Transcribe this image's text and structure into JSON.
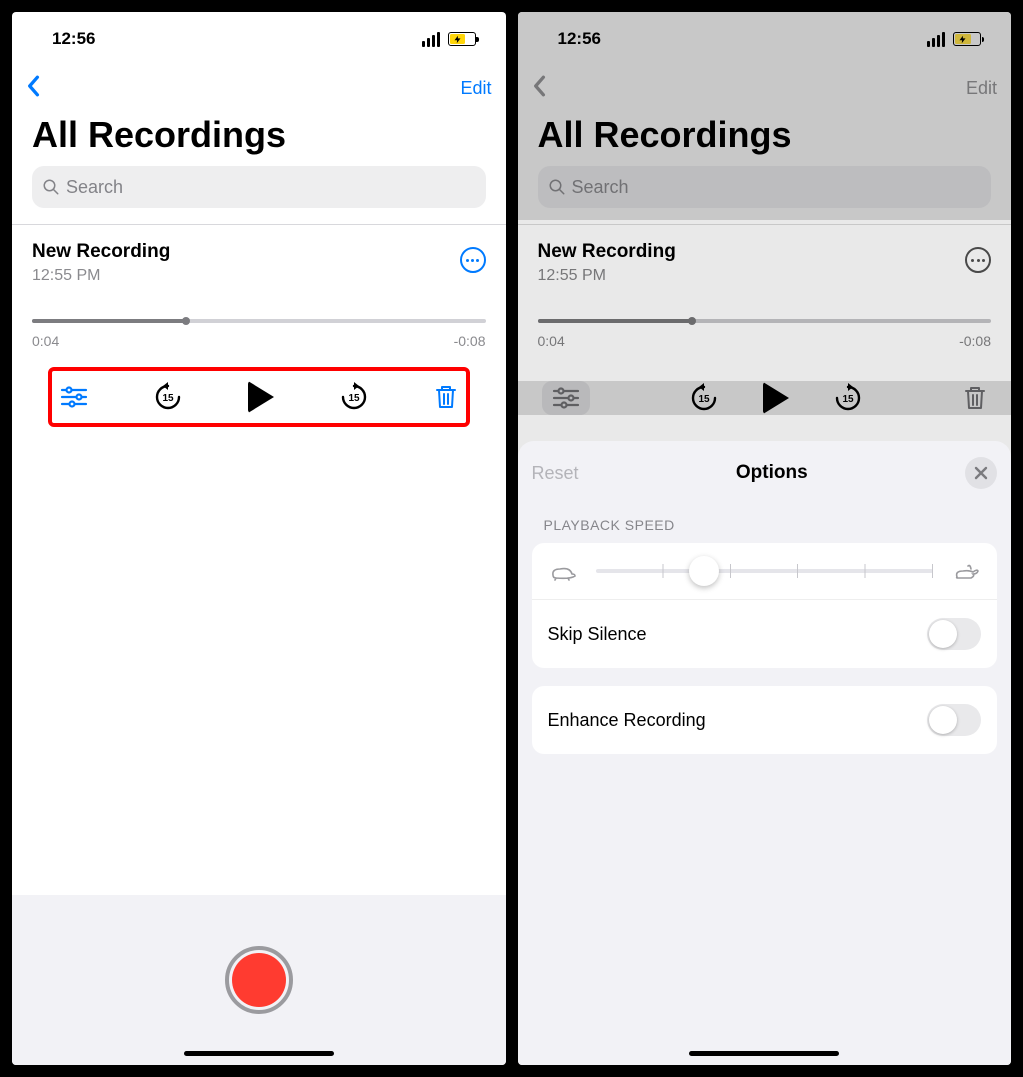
{
  "status": {
    "time": "12:56"
  },
  "nav": {
    "edit_label": "Edit"
  },
  "title": "All Recordings",
  "search": {
    "placeholder": "Search"
  },
  "recording": {
    "title": "New Recording",
    "subtitle": "12:55 PM",
    "elapsed": "0:04",
    "remaining": "-0:08",
    "progress_pct": 34
  },
  "options": {
    "reset_label": "Reset",
    "title": "Options",
    "playback_speed_label": "PLAYBACK SPEED",
    "speed_knob_pct": 32,
    "skip_silence_label": "Skip Silence",
    "enhance_label": "Enhance Recording"
  }
}
